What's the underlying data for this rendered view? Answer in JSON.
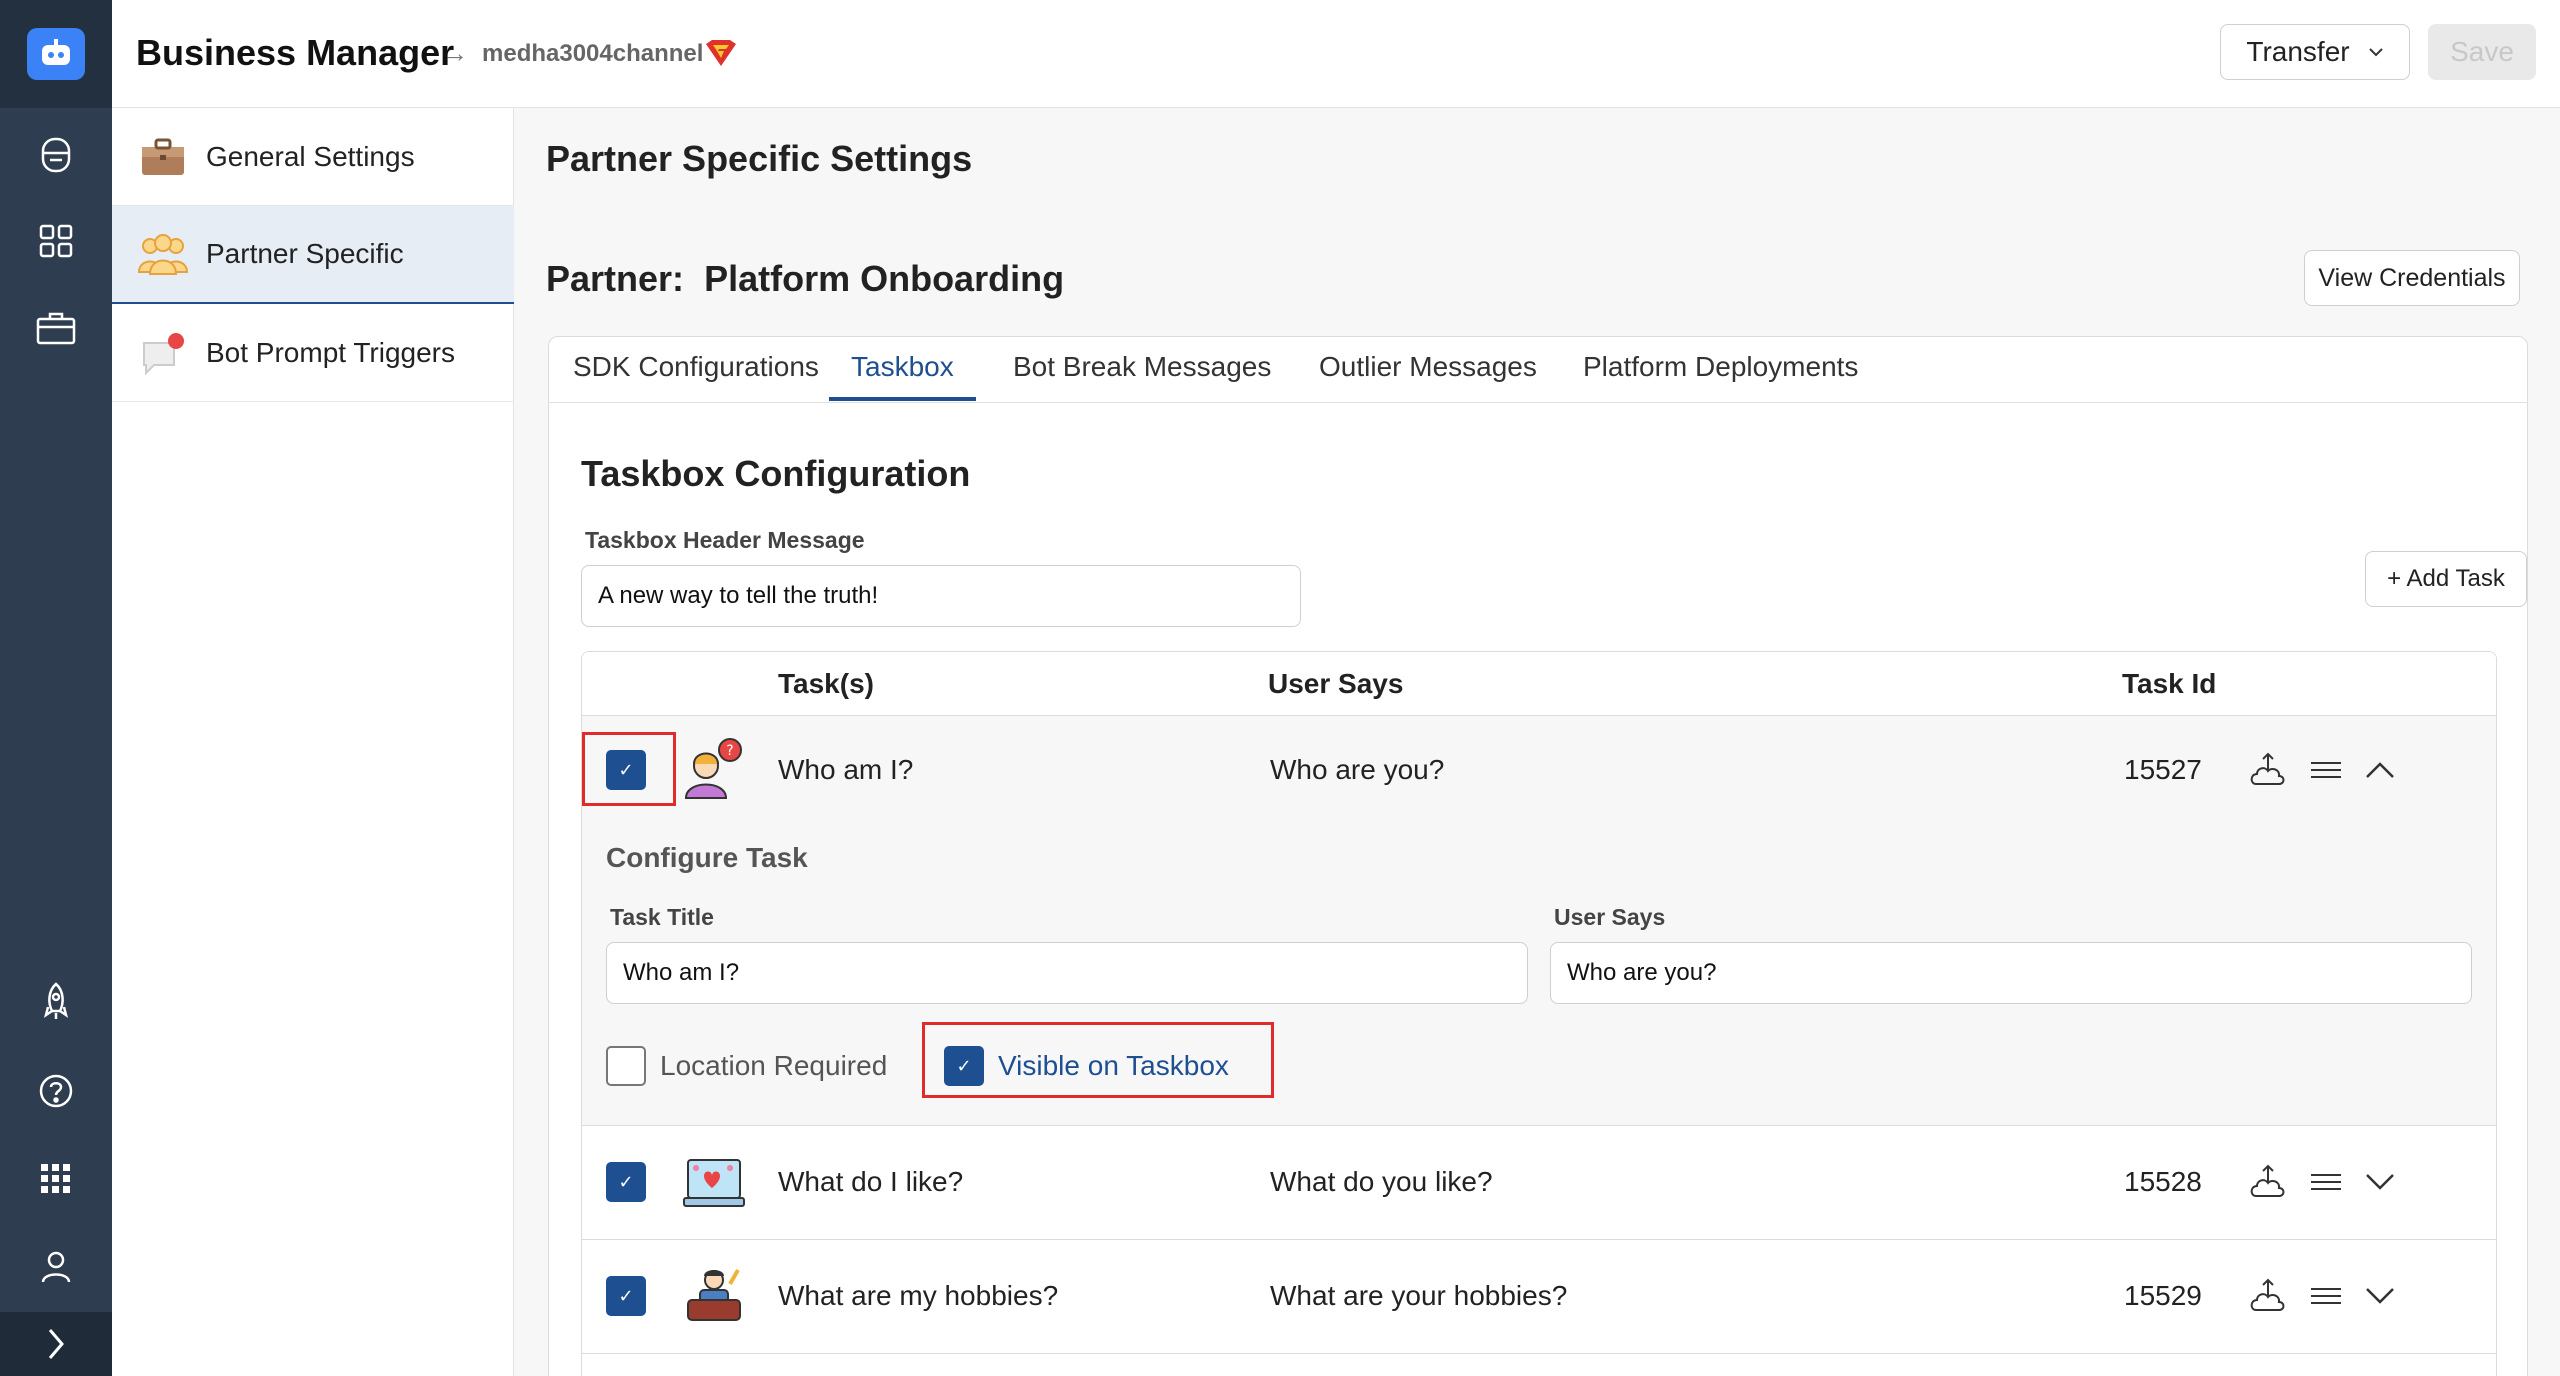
{
  "header": {
    "title": "Business Manager",
    "breadcrumb_arrow": "→",
    "channel": "medha3004channel",
    "transfer_label": "Transfer",
    "save_label": "Save"
  },
  "subnav": {
    "items": [
      {
        "label": "General Settings",
        "icon": "briefcase-icon"
      },
      {
        "label": "Partner Specific",
        "icon": "people-group-icon",
        "active": true
      },
      {
        "label": "Bot Prompt Triggers",
        "icon": "chat-bubble-icon"
      }
    ]
  },
  "main": {
    "page_title": "Partner Specific Settings",
    "partner_label": "Partner:",
    "partner_name": "Platform Onboarding",
    "view_credentials": "View Credentials",
    "tabs": [
      {
        "label": "SDK Configurations"
      },
      {
        "label": "Taskbox",
        "active": true
      },
      {
        "label": "Bot Break Messages"
      },
      {
        "label": "Outlier Messages"
      },
      {
        "label": "Platform Deployments"
      }
    ],
    "taskbox": {
      "section_title": "Taskbox Configuration",
      "header_message_label": "Taskbox Header Message",
      "header_message_value": "A new way to tell the truth!",
      "add_task_label": "+ Add Task",
      "columns": [
        "Task(s)",
        "User Says",
        "Task Id"
      ],
      "rows": [
        {
          "title": "Who am I?",
          "user_says": "Who are you?",
          "task_id": "15527",
          "checked": true,
          "expanded": true
        },
        {
          "title": "What do I like?",
          "user_says": "What do you like?",
          "task_id": "15528",
          "checked": true,
          "expanded": false
        },
        {
          "title": "What are my hobbies?",
          "user_says": "What are your hobbies?",
          "task_id": "15529",
          "checked": true,
          "expanded": false
        }
      ],
      "configure": {
        "title": "Configure Task",
        "task_title_label": "Task Title",
        "task_title_value": "Who am I?",
        "user_says_label": "User Says",
        "user_says_value": "Who are you?",
        "location_required_label": "Location Required",
        "location_required": false,
        "visible_on_taskbox_label": "Visible on Taskbox",
        "visible_on_taskbox": true
      }
    }
  },
  "colors": {
    "rail": "#2e3d4f",
    "accent": "#1d4f91",
    "highlight": "#e02b2b"
  }
}
